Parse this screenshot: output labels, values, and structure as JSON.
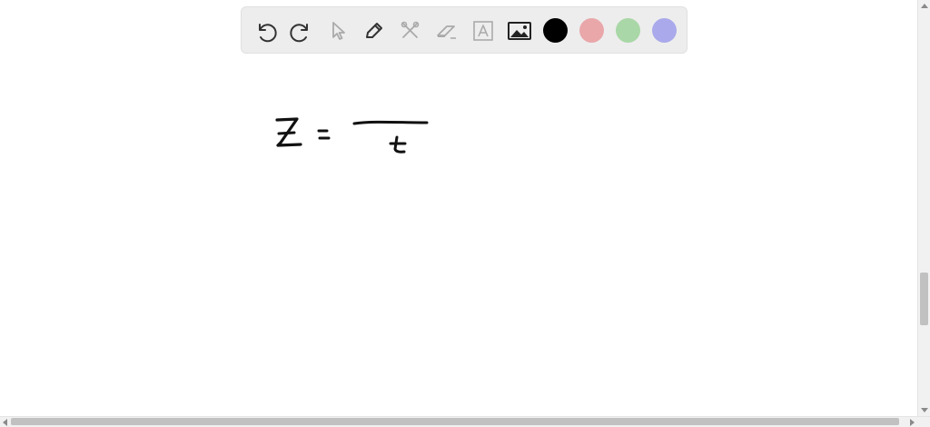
{
  "toolbar": {
    "tools": [
      {
        "name": "undo",
        "icon": "undo-icon",
        "enabled": true
      },
      {
        "name": "redo",
        "icon": "redo-icon",
        "enabled": true
      },
      {
        "name": "select",
        "icon": "pointer-icon",
        "enabled": false
      },
      {
        "name": "pen",
        "icon": "pencil-icon",
        "enabled": true
      },
      {
        "name": "tools",
        "icon": "scissors-icon",
        "enabled": false
      },
      {
        "name": "eraser",
        "icon": "eraser-icon",
        "enabled": false
      },
      {
        "name": "text",
        "icon": "text-box-icon",
        "enabled": false
      },
      {
        "name": "image",
        "icon": "image-icon",
        "enabled": true
      }
    ],
    "colors": [
      {
        "name": "black",
        "hex": "#000000",
        "selected": true
      },
      {
        "name": "red",
        "hex": "#e9a7aa"
      },
      {
        "name": "green",
        "hex": "#a9d7a7"
      },
      {
        "name": "blue",
        "hex": "#a9a9eb"
      }
    ]
  },
  "canvas": {
    "background": "#ffffff",
    "ink_color": "#111111",
    "strokes": [
      "Z",
      "=",
      "fraction-bar",
      "t"
    ]
  }
}
